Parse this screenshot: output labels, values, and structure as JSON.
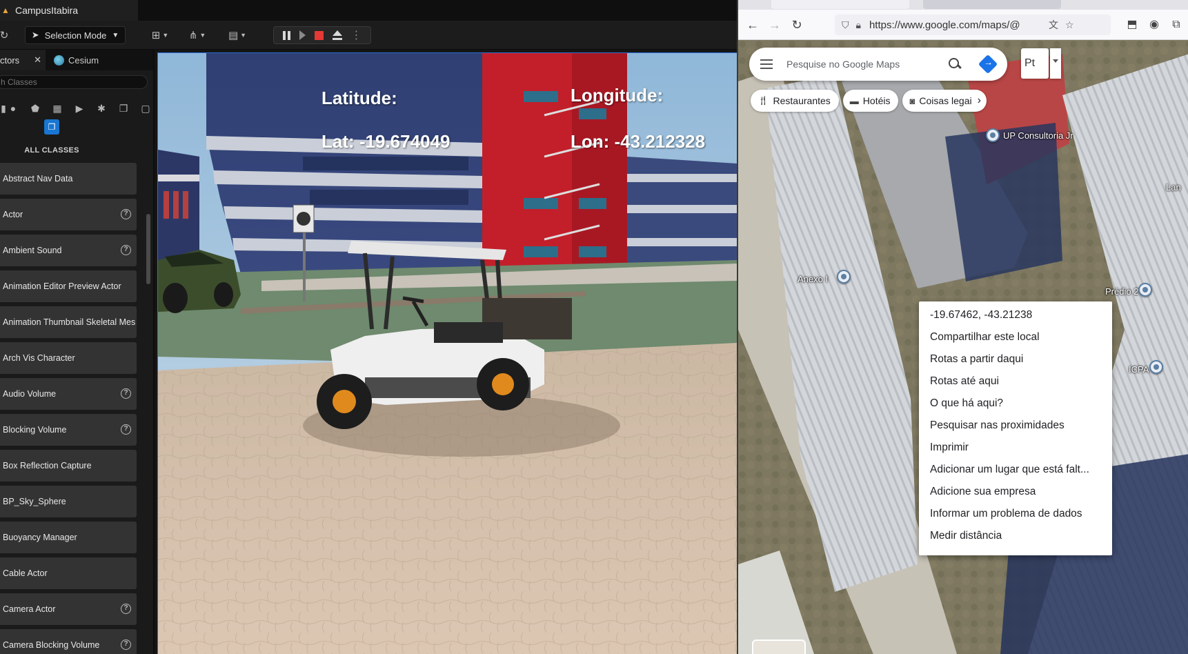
{
  "unreal": {
    "project_title": "CampusItabira",
    "toolbar": {
      "selection_mode": "Selection Mode"
    },
    "panel": {
      "tab_actors": "ctors",
      "tab_cesium": "Cesium",
      "search_placeholder": "h Classes",
      "all_classes_label": "ALL CLASSES",
      "items": [
        {
          "label": "Abstract Nav Data",
          "help": false
        },
        {
          "label": "Actor",
          "help": true
        },
        {
          "label": "Ambient Sound",
          "help": true
        },
        {
          "label": "Animation Editor Preview Actor",
          "help": false
        },
        {
          "label": "Animation Thumbnail Skeletal Mes",
          "help": false
        },
        {
          "label": "Arch Vis Character",
          "help": false
        },
        {
          "label": "Audio Volume",
          "help": true
        },
        {
          "label": "Blocking Volume",
          "help": true
        },
        {
          "label": "Box Reflection Capture",
          "help": false
        },
        {
          "label": "BP_Sky_Sphere",
          "help": false
        },
        {
          "label": "Buoyancy Manager",
          "help": false
        },
        {
          "label": "Cable Actor",
          "help": false
        },
        {
          "label": "Camera Actor",
          "help": true
        },
        {
          "label": "Camera Blocking Volume",
          "help": true
        }
      ]
    },
    "viewport": {
      "lat_label": "Latitude:",
      "lat_value": "Lat: -19.674049",
      "lon_label": "Longitude:",
      "lon_value": "Lon: -43.212328"
    }
  },
  "browser": {
    "url": "https://www.google.com/maps/@",
    "search_placeholder": "Pesquise no Google Maps",
    "lang_button": "Pt",
    "chips": [
      "Restaurantes",
      "Hotéis",
      "Coisas legai"
    ],
    "places": {
      "up_consultoria": "UP Consultoria Jr",
      "anexo": "Anexo I",
      "predio2": "Prédio 2",
      "icpa": "ICPA",
      "lan": "Lan"
    },
    "context_menu": [
      "-19.67462, -43.21238",
      "Compartilhar este local",
      "Rotas a partir daqui",
      "Rotas até aqui",
      "O que há aqui?",
      "Pesquisar nas proximidades",
      "Imprimir",
      "Adicionar um lugar que está falt...",
      "Adicione sua empresa",
      "Informar um problema de dados",
      "Medir distância"
    ]
  }
}
